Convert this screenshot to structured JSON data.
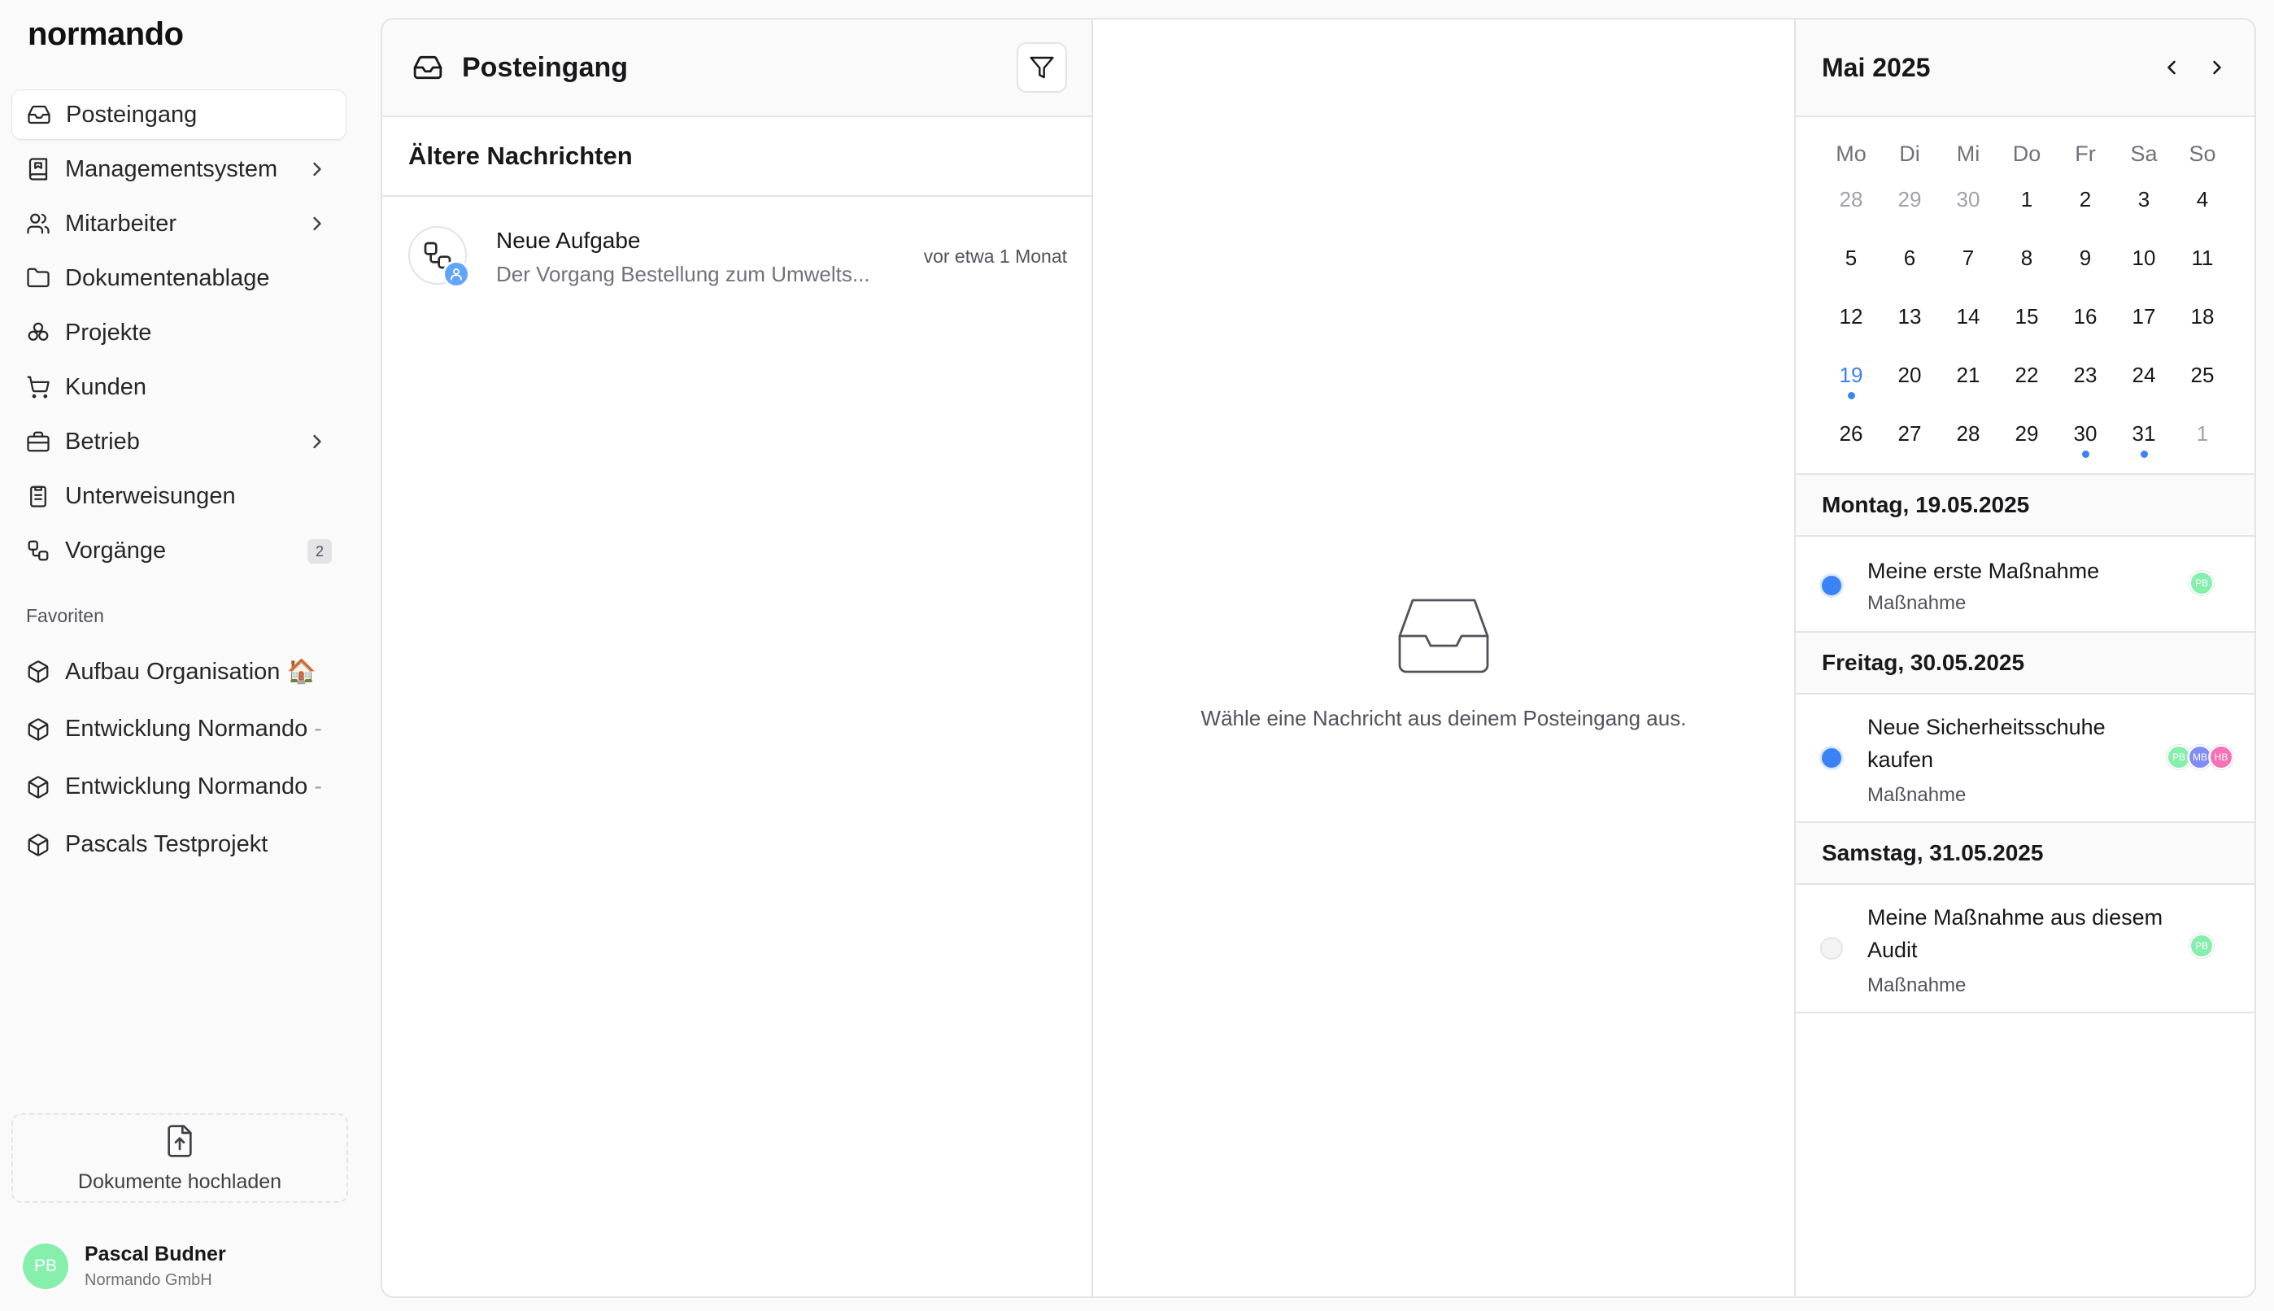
{
  "app": {
    "logo": "normando"
  },
  "sidebar": {
    "items": [
      {
        "label": "Posteingang",
        "icon": "inbox-icon",
        "active": true
      },
      {
        "label": "Managementsystem",
        "icon": "book-icon",
        "chevron": true
      },
      {
        "label": "Mitarbeiter",
        "icon": "users-icon",
        "chevron": true
      },
      {
        "label": "Dokumentenablage",
        "icon": "folder-icon"
      },
      {
        "label": "Projekte",
        "icon": "boxes-icon"
      },
      {
        "label": "Kunden",
        "icon": "cart-icon"
      },
      {
        "label": "Betrieb",
        "icon": "briefcase-icon",
        "chevron": true
      },
      {
        "label": "Unterweisungen",
        "icon": "clipboard-icon"
      },
      {
        "label": "Vorgänge",
        "icon": "workflow-icon",
        "badge": "2"
      }
    ],
    "favorites_title": "Favoriten",
    "favorites": [
      {
        "label": "Aufbau Organisation 🏠",
        "suffix": ""
      },
      {
        "label": "Entwicklung Normando",
        "suffix": "-"
      },
      {
        "label": "Entwicklung Normando",
        "suffix": "-"
      },
      {
        "label": "Pascals Testprojekt",
        "suffix": ""
      }
    ],
    "upload_label": "Dokumente hochladen",
    "user": {
      "initials": "PB",
      "name": "Pascal Budner",
      "org": "Normando GmbH",
      "color": "#86efac"
    }
  },
  "inbox": {
    "title": "Posteingang",
    "section": "Ältere Nachrichten",
    "messages": [
      {
        "title": "Neue Aufgabe",
        "preview": "Der Vorgang Bestellung zum Umwelts...",
        "time": "vor etwa 1 Monat"
      }
    ]
  },
  "detail": {
    "empty_text": "Wähle eine Nachricht aus deinem Posteingang aus."
  },
  "calendar": {
    "month": "Mai 2025",
    "weekdays": [
      "Mo",
      "Di",
      "Mi",
      "Do",
      "Fr",
      "Sa",
      "So"
    ],
    "weeks": [
      [
        {
          "d": "28",
          "m": true
        },
        {
          "d": "29",
          "m": true
        },
        {
          "d": "30",
          "m": true
        },
        {
          "d": "1"
        },
        {
          "d": "2"
        },
        {
          "d": "3"
        },
        {
          "d": "4"
        }
      ],
      [
        {
          "d": "5"
        },
        {
          "d": "6"
        },
        {
          "d": "7"
        },
        {
          "d": "8"
        },
        {
          "d": "9"
        },
        {
          "d": "10"
        },
        {
          "d": "11"
        }
      ],
      [
        {
          "d": "12"
        },
        {
          "d": "13"
        },
        {
          "d": "14"
        },
        {
          "d": "15"
        },
        {
          "d": "16"
        },
        {
          "d": "17"
        },
        {
          "d": "18"
        }
      ],
      [
        {
          "d": "19",
          "today": true,
          "dot": true
        },
        {
          "d": "20"
        },
        {
          "d": "21"
        },
        {
          "d": "22"
        },
        {
          "d": "23"
        },
        {
          "d": "24"
        },
        {
          "d": "25"
        }
      ],
      [
        {
          "d": "26"
        },
        {
          "d": "27"
        },
        {
          "d": "28"
        },
        {
          "d": "29"
        },
        {
          "d": "30",
          "dot": true
        },
        {
          "d": "31",
          "dot": true
        },
        {
          "d": "1",
          "m": true
        }
      ]
    ],
    "days": [
      {
        "heading": "Montag, 19.05.2025",
        "events": [
          {
            "title": "Meine erste Maßnahme",
            "type": "Maßnahme",
            "status": "open",
            "assignees": [
              {
                "initials": "PB",
                "color": "#86efac"
              }
            ]
          }
        ]
      },
      {
        "heading": "Freitag, 30.05.2025",
        "events": [
          {
            "title": "Neue Sicherheitsschuhe kaufen",
            "type": "Maßnahme",
            "status": "open",
            "assignees": [
              {
                "initials": "PB",
                "color": "#86efac"
              },
              {
                "initials": "MB",
                "color": "#818cf8"
              },
              {
                "initials": "HB",
                "color": "#f472b6"
              }
            ]
          }
        ]
      },
      {
        "heading": "Samstag, 31.05.2025",
        "events": [
          {
            "title": "Meine Maßnahme aus diesem Audit",
            "type": "Maßnahme",
            "status": "none",
            "assignees": [
              {
                "initials": "PB",
                "color": "#86efac"
              }
            ]
          }
        ]
      }
    ]
  },
  "colors": {
    "accent": "#3b82f6",
    "border": "#e4e4e7",
    "text": "#18181b",
    "muted": "#71717a"
  }
}
